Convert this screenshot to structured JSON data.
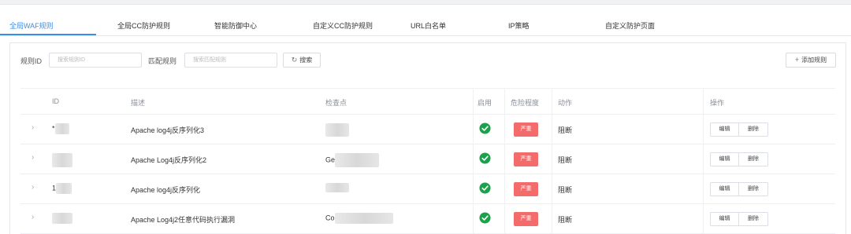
{
  "tabs": [
    {
      "label": "全局WAF规则",
      "active": true
    },
    {
      "label": "全局CC防护规则"
    },
    {
      "label": "智能防御中心"
    },
    {
      "label": "自定义CC防护规则"
    },
    {
      "label": "URL白名单"
    },
    {
      "label": "IP策略"
    },
    {
      "label": "自定义防护页面"
    }
  ],
  "search": {
    "rule_id_label": "规则ID",
    "rule_id_placeholder": "搜索规则ID",
    "match_rule_label": "匹配规则",
    "match_rule_placeholder": "搜索匹配规则",
    "search_button": "搜索",
    "add_button": "添加规则"
  },
  "table": {
    "headers": {
      "id": "ID",
      "desc": "描述",
      "check": "检查点",
      "enabled": "启用",
      "danger": "危险程度",
      "action": "动作",
      "ops": "操作"
    },
    "rows": [
      {
        "id_visible": "*",
        "desc": "Apache log4j反序列化3",
        "check_visible": "",
        "enabled": true,
        "danger": "严重",
        "action": "阻断",
        "edit": "编辑",
        "delete": "删除"
      },
      {
        "id_visible": "",
        "desc": "Apache Log4j反序列化2",
        "check_visible": "Ge",
        "enabled": true,
        "danger": "严重",
        "action": "阻断",
        "edit": "编辑",
        "delete": "删除"
      },
      {
        "id_visible": "1",
        "desc": "Apache log4j反序列化",
        "check_visible": "",
        "enabled": true,
        "danger": "严重",
        "action": "阻断",
        "edit": "编辑",
        "delete": "删除"
      },
      {
        "id_visible": "",
        "desc": "Apache Log4j2任意代码执行漏洞",
        "check_visible": "Co",
        "enabled": true,
        "danger": "严重",
        "action": "阻断",
        "edit": "编辑",
        "delete": "删除"
      }
    ]
  },
  "colors": {
    "accent": "#3b8ee6",
    "danger_badge": "#f36b6b",
    "enabled_check": "#16a34a"
  },
  "icons": {
    "search_button": "refresh-icon",
    "add_button": "plus-icon",
    "row_expand": "chevron-right-icon",
    "enabled": "check-circle-icon"
  }
}
